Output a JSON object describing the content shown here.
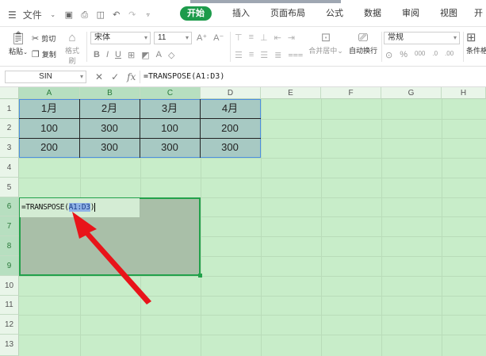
{
  "menubar": {
    "file_label": "文件",
    "tabs": [
      "开始",
      "插入",
      "页面布局",
      "公式",
      "数据",
      "审阅",
      "视图",
      "开"
    ],
    "active_tab": "开始"
  },
  "ribbon": {
    "paste_label": "粘贴",
    "cut_label": "剪切",
    "copy_label": "复制",
    "format_painter_label": "格式刷",
    "font_name": "宋体",
    "font_size": "11",
    "merge_center_label": "合并居中",
    "wrap_text_label": "自动换行",
    "number_format": "常规",
    "conditional_label": "条件格"
  },
  "formula_bar": {
    "name_box": "SIN",
    "fx_label": "fx",
    "formula": "=TRANSPOSE(A1:D3)"
  },
  "sheet": {
    "columns": [
      "A",
      "B",
      "C",
      "D",
      "E",
      "F",
      "G",
      "H"
    ],
    "rows": [
      "1",
      "2",
      "3",
      "4",
      "5",
      "6",
      "7",
      "8",
      "9",
      "10",
      "11",
      "12",
      "13"
    ],
    "data": [
      [
        "1月",
        "2月",
        "3月",
        "4月"
      ],
      [
        "100",
        "300",
        "100",
        "200"
      ],
      [
        "200",
        "300",
        "300",
        "300"
      ]
    ],
    "edit_prefix": "=TRANSPOSE(",
    "edit_ref": "A1:D3",
    "edit_suffix": ")"
  },
  "colors": {
    "sheet_background": "#c8edc9",
    "accent": "#1d9b4b",
    "annotation_arrow": "#e8141a"
  }
}
